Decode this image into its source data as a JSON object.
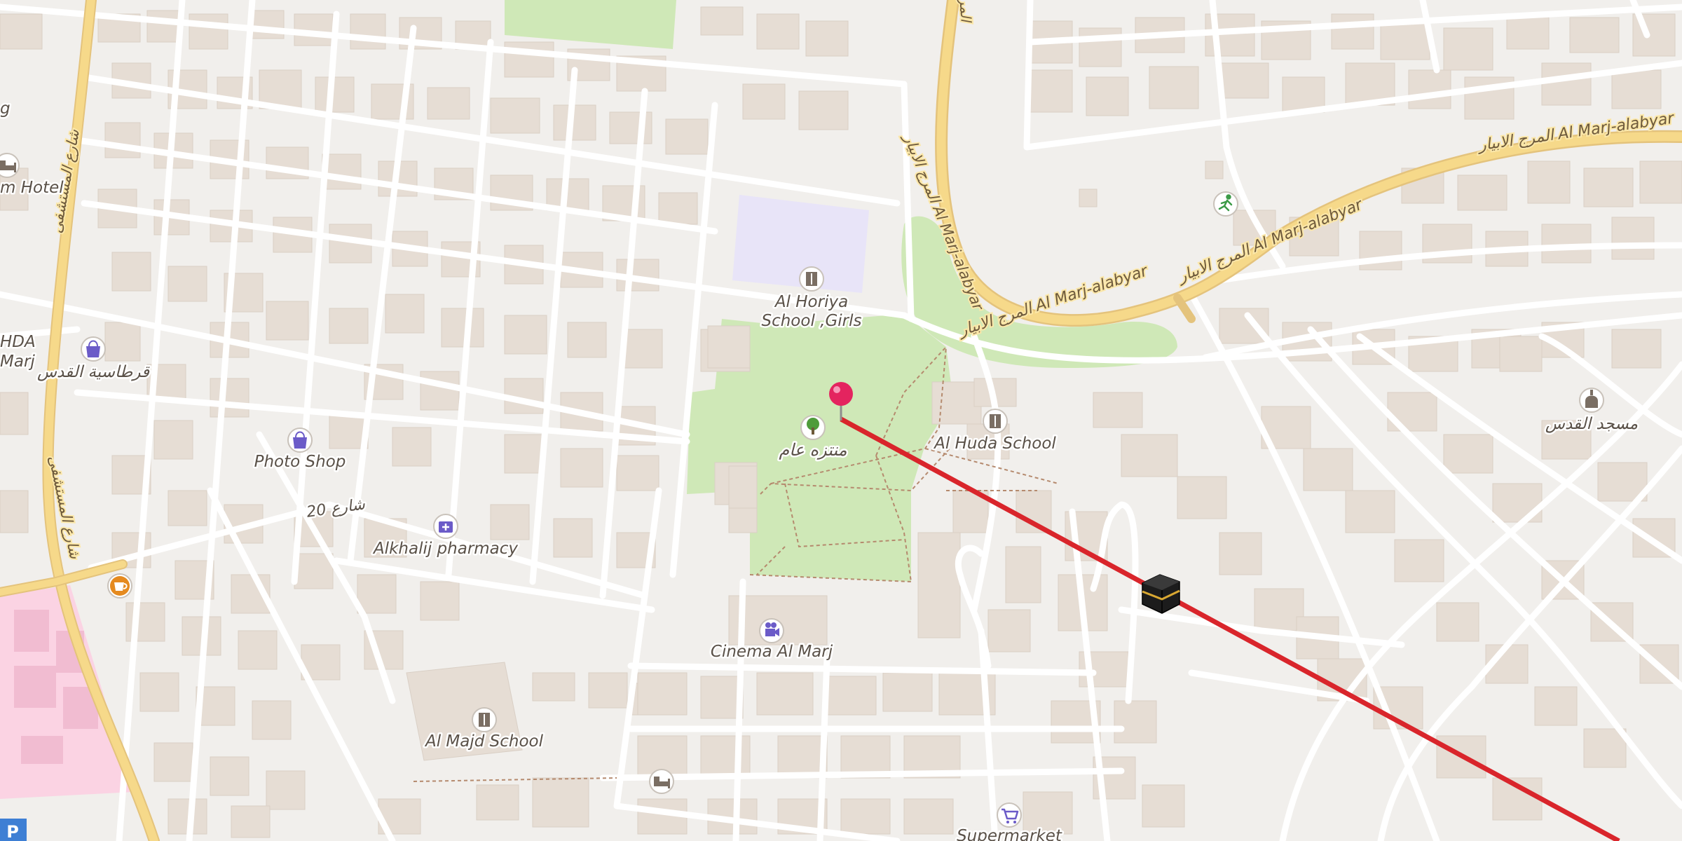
{
  "map": {
    "colors": {
      "background": "#f1efec",
      "park": "#cfe8b7",
      "school_area": "#e8e4f8",
      "hospital_area": "#fbd3e3",
      "primary_road": "#f6d98a",
      "minor_road": "#ffffff",
      "route_line": "#d9252b",
      "pin": "#e4245f"
    },
    "pois": [
      {
        "id": "al-horiya-school-girls",
        "icon": "school-icon",
        "label_line1": "Al Horiya",
        "label_line2": "School ,Girls"
      },
      {
        "id": "public-park",
        "icon": "tree-icon",
        "label": "منتزه عام"
      },
      {
        "id": "al-huda-school",
        "icon": "school-icon",
        "label": "Al Huda School"
      },
      {
        "id": "photo-shop",
        "icon": "shopping-bag-icon",
        "label": "Photo Shop"
      },
      {
        "id": "alkhalij-pharmacy",
        "icon": "pharmacy-icon",
        "label": "Alkhalij pharmacy"
      },
      {
        "id": "cinema-al-marj",
        "icon": "cinema-icon",
        "label": "Cinema Al Marj"
      },
      {
        "id": "al-majd-school",
        "icon": "school-icon",
        "label": "Al Majd School"
      },
      {
        "id": "mosque-al-quds",
        "icon": "mosque-icon",
        "label": "مسجد القدس"
      },
      {
        "id": "stationery-al-quds",
        "icon": "shopping-bag-icon",
        "label": "قرطاسية القدس"
      },
      {
        "id": "supermarket",
        "icon": "cart-icon",
        "label": "Supermarket"
      },
      {
        "id": "hotel-left",
        "icon": "bed-icon",
        "label": "m Hotel"
      },
      {
        "id": "hotel-bottom",
        "icon": "bed-icon",
        "label": ""
      },
      {
        "id": "cafe",
        "icon": "cup-icon",
        "label": ""
      },
      {
        "id": "sports",
        "icon": "runner-icon",
        "label": ""
      },
      {
        "id": "parking",
        "icon": "parking-icon",
        "label": "P"
      }
    ],
    "roads": {
      "al_marj_alabyar_1": "المرج الابيار Al Marj-alabyar",
      "al_marj_alabyar_2": "المرج الابيار Al Marj-alabyar",
      "al_marj_alabyar_3": "المرج الابيار Al Marj-alabyar",
      "hospital_street_1": "شارع المستشفى",
      "hospital_street_2": "شارع المستشفى",
      "street_20": "شارع 20"
    },
    "edge_labels": {
      "left_partial_1": "g",
      "left_partial_2": "HDA",
      "left_partial_3": "Marj",
      "top_partial": "المرج"
    }
  }
}
